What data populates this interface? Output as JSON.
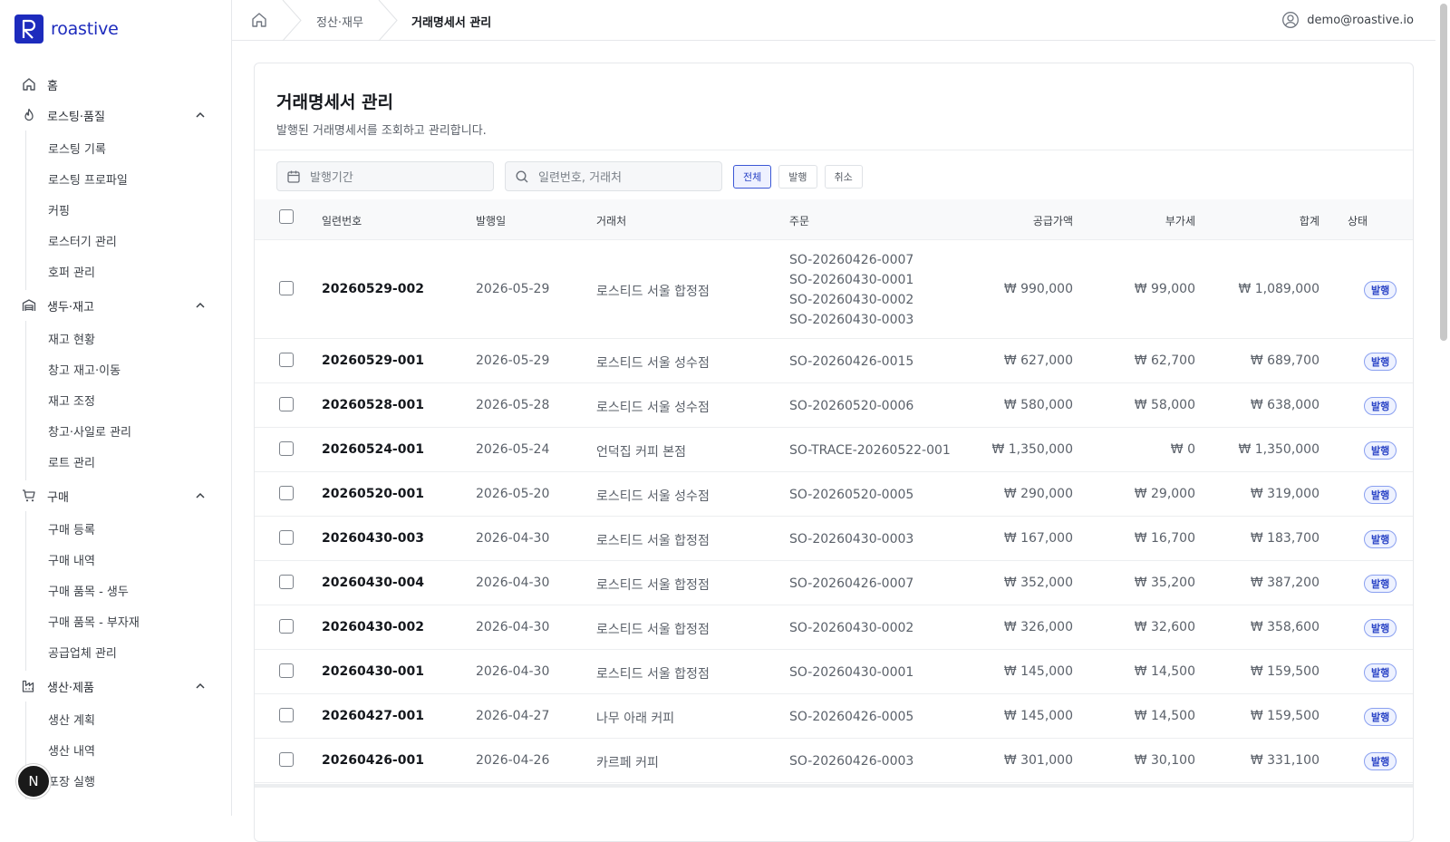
{
  "brand": {
    "name": "roastive"
  },
  "sidebar": {
    "home": "홈",
    "groups": [
      {
        "label": "로스팅·품질",
        "icon": "flame-icon",
        "items": [
          "로스팅 기록",
          "로스팅 프로파일",
          "커핑",
          "로스터기 관리",
          "호퍼 관리"
        ]
      },
      {
        "label": "생두·재고",
        "icon": "warehouse-icon",
        "items": [
          "재고 현황",
          "창고 재고·이동",
          "재고 조정",
          "창고·사일로 관리",
          "로트 관리"
        ]
      },
      {
        "label": "구매",
        "icon": "cart-icon",
        "items": [
          "구매 등록",
          "구매 내역",
          "구매 품목 - 생두",
          "구매 품목 - 부자재",
          "공급업체 관리"
        ]
      },
      {
        "label": "생산·제품",
        "icon": "factory-icon",
        "items": [
          "생산 계획",
          "생산 내역",
          "포장 실행"
        ]
      }
    ]
  },
  "floating": {
    "avatar_letter": "N"
  },
  "topbar": {
    "breadcrumb": [
      "정산·재무",
      "거래명세서 관리"
    ],
    "user_email": "demo@roastive.io"
  },
  "page": {
    "title": "거래명세서 관리",
    "description": "발행된 거래명세서를 조회하고 관리합니다."
  },
  "filters": {
    "date_placeholder": "발행기간",
    "search_placeholder": "일련번호, 거래처",
    "segments": [
      "전체",
      "발행",
      "취소"
    ],
    "active_segment": "전체"
  },
  "table": {
    "headers": [
      "일련번호",
      "발행일",
      "거래처",
      "주문",
      "공급가액",
      "부가세",
      "합계",
      "상태"
    ],
    "rows": [
      {
        "serial": "20260529-002",
        "date": "2026-05-29",
        "client": "로스티드 서울 합정점",
        "orders": [
          "SO-20260426-0007",
          "SO-20260430-0001",
          "SO-20260430-0002",
          "SO-20260430-0003"
        ],
        "supply": "₩ 990,000",
        "vat": "₩ 99,000",
        "total": "₩ 1,089,000",
        "status": "발행"
      },
      {
        "serial": "20260529-001",
        "date": "2026-05-29",
        "client": "로스티드 서울 성수점",
        "orders": [
          "SO-20260426-0015"
        ],
        "supply": "₩ 627,000",
        "vat": "₩ 62,700",
        "total": "₩ 689,700",
        "status": "발행"
      },
      {
        "serial": "20260528-001",
        "date": "2026-05-28",
        "client": "로스티드 서울 성수점",
        "orders": [
          "SO-20260520-0006"
        ],
        "supply": "₩ 580,000",
        "vat": "₩ 58,000",
        "total": "₩ 638,000",
        "status": "발행"
      },
      {
        "serial": "20260524-001",
        "date": "2026-05-24",
        "client": "언덕집 커피 본점",
        "orders": [
          "SO-TRACE-20260522-001"
        ],
        "supply": "₩ 1,350,000",
        "vat": "₩ 0",
        "total": "₩ 1,350,000",
        "status": "발행"
      },
      {
        "serial": "20260520-001",
        "date": "2026-05-20",
        "client": "로스티드 서울 성수점",
        "orders": [
          "SO-20260520-0005"
        ],
        "supply": "₩ 290,000",
        "vat": "₩ 29,000",
        "total": "₩ 319,000",
        "status": "발행"
      },
      {
        "serial": "20260430-003",
        "date": "2026-04-30",
        "client": "로스티드 서울 합정점",
        "orders": [
          "SO-20260430-0003"
        ],
        "supply": "₩ 167,000",
        "vat": "₩ 16,700",
        "total": "₩ 183,700",
        "status": "발행"
      },
      {
        "serial": "20260430-004",
        "date": "2026-04-30",
        "client": "로스티드 서울 합정점",
        "orders": [
          "SO-20260426-0007"
        ],
        "supply": "₩ 352,000",
        "vat": "₩ 35,200",
        "total": "₩ 387,200",
        "status": "발행"
      },
      {
        "serial": "20260430-002",
        "date": "2026-04-30",
        "client": "로스티드 서울 합정점",
        "orders": [
          "SO-20260430-0002"
        ],
        "supply": "₩ 326,000",
        "vat": "₩ 32,600",
        "total": "₩ 358,600",
        "status": "발행"
      },
      {
        "serial": "20260430-001",
        "date": "2026-04-30",
        "client": "로스티드 서울 합정점",
        "orders": [
          "SO-20260430-0001"
        ],
        "supply": "₩ 145,000",
        "vat": "₩ 14,500",
        "total": "₩ 159,500",
        "status": "발행"
      },
      {
        "serial": "20260427-001",
        "date": "2026-04-27",
        "client": "나무 아래 커피",
        "orders": [
          "SO-20260426-0005"
        ],
        "supply": "₩ 145,000",
        "vat": "₩ 14,500",
        "total": "₩ 159,500",
        "status": "발행"
      },
      {
        "serial": "20260426-001",
        "date": "2026-04-26",
        "client": "카르페 커피",
        "orders": [
          "SO-20260426-0003"
        ],
        "supply": "₩ 301,000",
        "vat": "₩ 30,100",
        "total": "₩ 331,100",
        "status": "발행"
      }
    ]
  },
  "colors": {
    "brand": "#1d2bbd",
    "badge_text": "#2a44c6",
    "badge_bg": "#eef2ff"
  }
}
